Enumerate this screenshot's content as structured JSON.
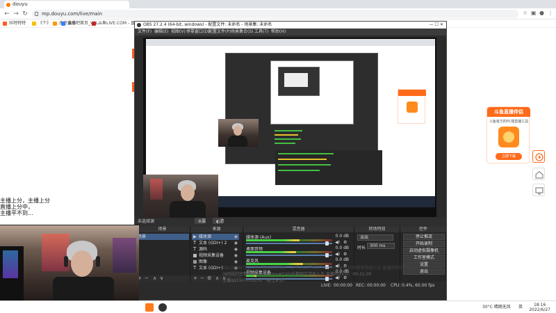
{
  "browser": {
    "tab_title": "douyu",
    "address": "mp.douyu.com/live/main",
    "bookmarks": [
      {
        "label": "抖特特特",
        "color": "#ff5d23"
      },
      {
        "label": "《个》",
        "color": "#f4c20d"
      },
      {
        "label": "虎牙直播",
        "color": "#ff9900"
      },
      {
        "label": "酒水吧首页_VAL...",
        "color": "#3b82f6"
      },
      {
        "label": "斗鱼LIVE.COM - 直...",
        "color": "#c62828"
      }
    ]
  },
  "obs": {
    "title": "OBS 27.2.4 (64-bit, windows) - 配置文件: 未命名 - 场景集: 未命名",
    "menu": [
      "文件(F)",
      "编辑(E)",
      "视图(V)",
      "停靠窗口(D)",
      "配置文件(P)",
      "场景集合(S)",
      "工具(T)",
      "帮助(H)"
    ],
    "no_source_selected": "未选择源",
    "properties_btn": "属性",
    "filters_btn": "滤镜",
    "docks": {
      "scenes": "场景",
      "sources": "来源",
      "mixer": "混音器",
      "transitions": "转场特效",
      "controls": "控件"
    },
    "scene_item": "场景",
    "sources": [
      {
        "icon": "play",
        "label": "媒体源",
        "selected": true
      },
      {
        "icon": "text",
        "label": "文本 (GDI+) 2",
        "selected": false
      },
      {
        "icon": "text",
        "label": "源码",
        "selected": false
      },
      {
        "icon": "camera",
        "label": "视频采集设备",
        "selected": false
      },
      {
        "icon": "image",
        "label": "图像",
        "selected": false
      },
      {
        "icon": "text",
        "label": "文本 (GDI+)",
        "selected": false
      }
    ],
    "mixer": [
      {
        "name": "媒体源 (Aux)",
        "db": "0.0 dB",
        "level": 0.62,
        "slider": 0.96
      },
      {
        "name": "桌面音频",
        "db": "0.0 dB",
        "level": 0.58,
        "slider": 0.96
      },
      {
        "name": "麦克风",
        "db": "0.0 dB",
        "level": 0.66,
        "slider": 0.96
      },
      {
        "name": "视频采集设备",
        "db": "0.0 dB",
        "level": 0.12,
        "slider": 0.96
      }
    ],
    "transition_name": "淡出",
    "duration_label": "时长",
    "duration_value": "300 ms",
    "controls": [
      "停止推流",
      "开始录制",
      "启动虚拟摄像机",
      "工作室模式",
      "设置",
      "退出"
    ],
    "status": {
      "live_label": "LIVE:",
      "live_time": "00:00:00",
      "rec_label": "REC:",
      "rec_time": "00:00:00",
      "cpu": "CPU: 0.4%, 60.00 fps"
    }
  },
  "promo": {
    "title": "斗鱼直播伴侣",
    "subtitle": "斗鱼官方的PC端直播工具",
    "logo_text": "DOUYU",
    "download": "立即下载"
  },
  "stream_info": {
    "line1": "VALORANT瓦手游比赛国际赛视频（上午10点开始)/7commy/#520/长期等游戏人王 直播时间(3)：00-21:00",
    "line2": "(6时段的完整时间) /7commy#520/长期固定游戏人王 直播时间(3)：00-21:00",
    "line3": "主播qq1145658250（备注来意）"
  },
  "overlay_text": "主播上分，主播上分\n直播上分中，\n主播平不到...",
  "taskbar": {
    "temp": "30°C 晴朗无风",
    "ime": "英",
    "time": "18:16",
    "date": "2022/6/27"
  }
}
